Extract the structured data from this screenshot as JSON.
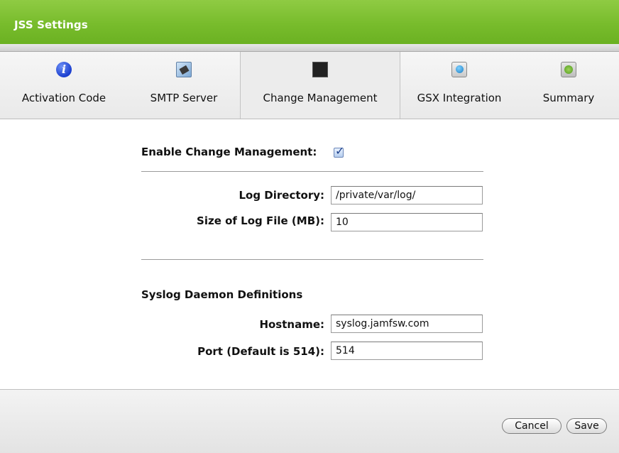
{
  "window": {
    "title": "JSS Settings"
  },
  "tabs": [
    {
      "label": "Activation Code",
      "icon": "info-icon",
      "active": false
    },
    {
      "label": "SMTP Server",
      "icon": "smtp-server-icon",
      "active": false
    },
    {
      "label": "Change Management",
      "icon": "console-log-icon",
      "active": true
    },
    {
      "label": "GSX Integration",
      "icon": "gsx-icon",
      "active": false
    },
    {
      "label": "Summary",
      "icon": "summary-icon",
      "active": false
    }
  ],
  "form": {
    "enable_label": "Enable Change Management:",
    "enable_checked": true,
    "log_directory_label": "Log Directory:",
    "log_directory_value": "/private/var/log/",
    "log_size_label": "Size of Log File (MB):",
    "log_size_value": "10",
    "syslog_heading": "Syslog Daemon Definitions",
    "hostname_label": "Hostname:",
    "hostname_value": "syslog.jamfsw.com",
    "port_label": "Port (Default is 514):",
    "port_value": "514"
  },
  "footer": {
    "cancel_label": "Cancel",
    "save_label": "Save"
  },
  "colors": {
    "titlebar": "#78bc2c",
    "checkbox_accent": "#1c3f8a"
  }
}
